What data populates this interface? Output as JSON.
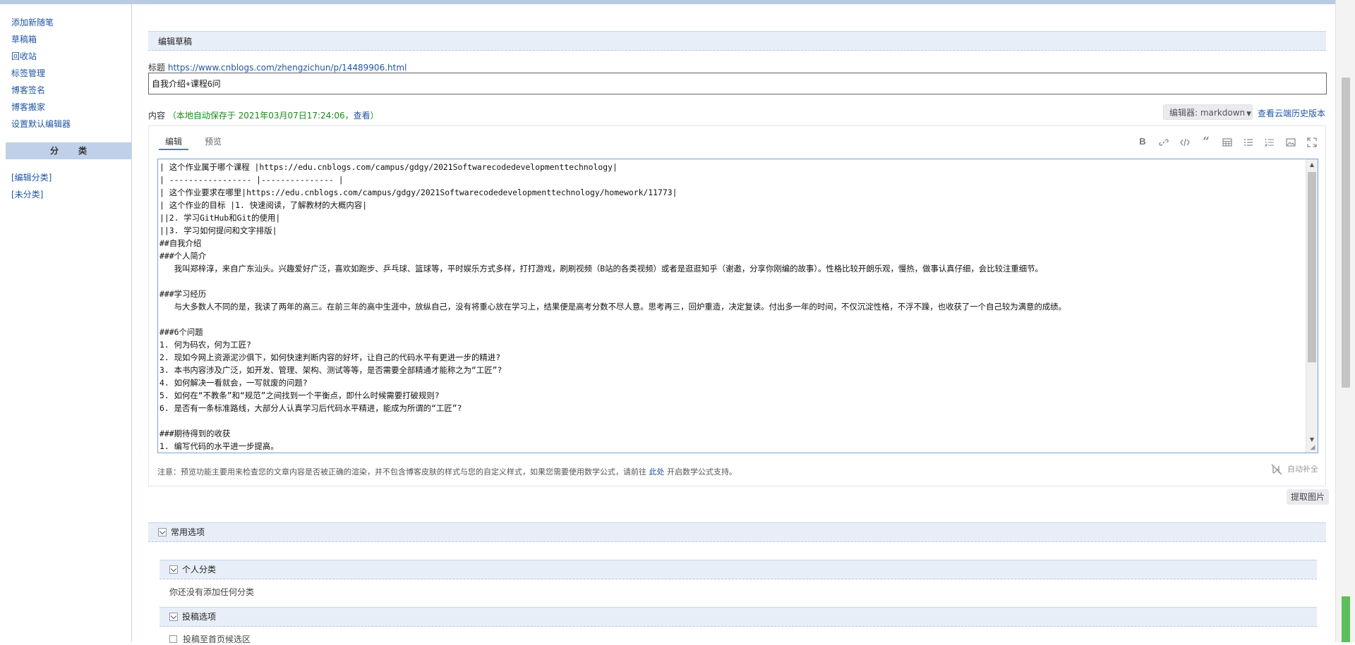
{
  "sidebar": {
    "links": [
      "添加新随笔",
      "草稿箱",
      "回收站",
      "标签管理",
      "博客签名",
      "博客搬家",
      "设置默认编辑器"
    ],
    "category_heading": "分类",
    "category_links": [
      "[编辑分类]",
      "[未分类]"
    ]
  },
  "section": {
    "title": "编辑草稿"
  },
  "title_field": {
    "label": "标题",
    "url": "https://www.cnblogs.com/zhengzichun/p/14489906.html",
    "value": "自我介绍+课程6问"
  },
  "content": {
    "label": "内容",
    "autosave_text": "（本地自动保存于 2021年03月07日17:24:06，",
    "view_link": "查看",
    "autosave_close": "）",
    "editor_select": "编辑器: markdown",
    "history_link": "查看云端历史版本"
  },
  "editor": {
    "tabs": [
      "编辑",
      "预览"
    ],
    "tools": [
      "bold-icon",
      "link-icon",
      "code-icon",
      "quote-icon",
      "table-icon",
      "unordered-list-icon",
      "ordered-list-icon",
      "image-icon",
      "fullscreen-icon"
    ],
    "lines": [
      "| 这个作业属于哪个课程 |https://edu.cnblogs.com/campus/gdgy/2021Softwarecodedevelopmenttechnology|",
      "| ----------------- |--------------- |",
      "| 这个作业要求在哪里|https://edu.cnblogs.com/campus/gdgy/2021Softwarecodedevelopmenttechnology/homework/11773|",
      "| 这个作业的目标 |1. 快速阅读，了解教材的大概内容|",
      "||2. 学习GitHub和Git的使用|",
      "||3. 学习如何提问和文字排版|",
      "##自我介绍",
      "###个人简介",
      "   我叫郑梓淳，来自广东汕头。兴趣爱好广泛，喜欢如跑步、乒乓球、篮球等，平时娱乐方式多样，打打游戏，刷刷视频（B站的各类视频）或者是逛逛知乎（谢邀，分享你刚编的故事）。性格比较开朗乐观，慢热，做事认真仔细，会比较注重细节。",
      "",
      "###学习经历",
      "   与大多数人不同的是，我读了两年的高三。在前三年的高中生涯中，放纵自己，没有将重心放在学习上，结果便是高考分数不尽人意。思考再三，回炉重造，决定复读。付出多一年的时间，不仅沉淀性格，不浮不躁，也收获了一个自己较为满意的成绩。",
      "",
      "###6个问题",
      "1. 何为码农，何为工匠?",
      "2. 现如今网上资源泥沙俱下，如何快速判断内容的好坏，让自己的代码水平有更进一步的精进?",
      "3. 本书内容涉及广泛，如开发、管理、架构、测试等等，是否需要全部精通才能称之为“工匠”?",
      "4. 如何解决一看就会，一写就废的问题?",
      "5. 如何在“不教条”和“规范”之间找到一个平衡点，即什么时候需要打破规则?",
      "6. 是否有一条标准路线，大部分人认真学习后代码水平精进，能成为所谓的“工匠”?",
      "",
      "###期待得到的收获",
      "1. 编写代码的水平进一步提高。"
    ],
    "note_prefix": "注意：预览功能主要用来检查您的文章内容是否被正确的渲染，并不包含博客皮肤的样式与您的自定义样式，如果您需要使用数学公式，请前往 ",
    "note_link": "此处",
    "note_suffix": " 开启数学公式支持。",
    "auto_space": "自动补全"
  },
  "extract_button": "提取图片",
  "panels": {
    "common_options": "常用选项",
    "personal_category": "个人分类",
    "no_category_text": "你还没有添加任何分类",
    "submit_options": "投稿选项",
    "homepage_candidate": "投稿至首页候选区"
  }
}
